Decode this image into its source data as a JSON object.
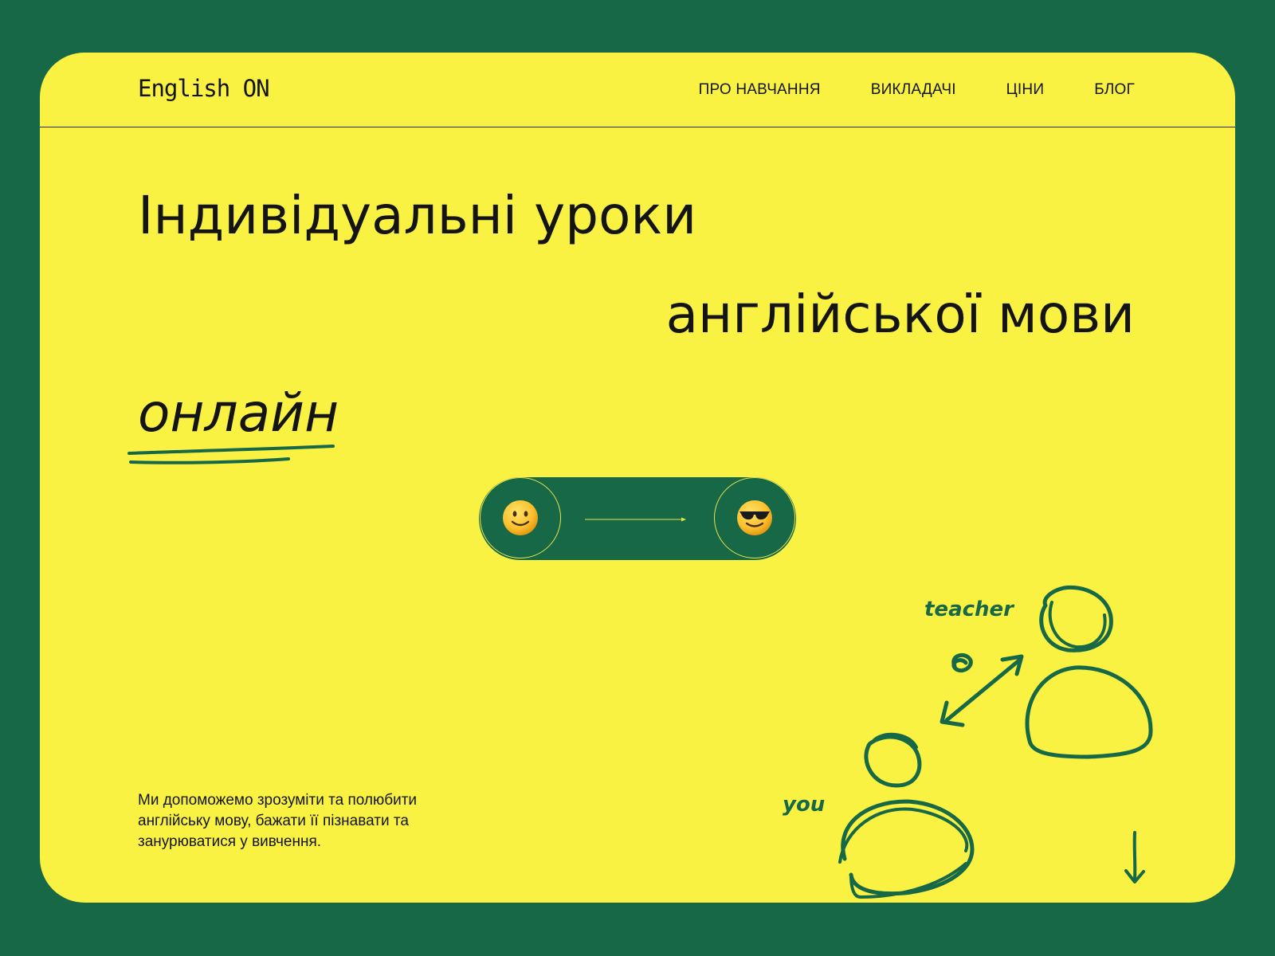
{
  "header": {
    "logo": "English ON",
    "nav": [
      {
        "label": "ПРО НАВЧАННЯ"
      },
      {
        "label": "ВИКЛАДАЧІ"
      },
      {
        "label": "ЦІНИ"
      },
      {
        "label": "БЛОГ"
      }
    ]
  },
  "hero": {
    "line1": "Індивідуальні уроки",
    "line2": "англійської мови",
    "line3": "онлайн"
  },
  "toggle": {
    "left_icon": "slight-smile-emoji",
    "right_icon": "sunglasses-emoji"
  },
  "illustration": {
    "teacher_label": "teacher",
    "you_label": "you"
  },
  "description": "Ми допоможемо зрозуміти та полюбити англійську мову, бажати її пізнавати та занурюватися у вивчення.",
  "colors": {
    "background": "#176847",
    "card": "#f9f243",
    "accent_green": "#176847",
    "text": "#141414"
  }
}
